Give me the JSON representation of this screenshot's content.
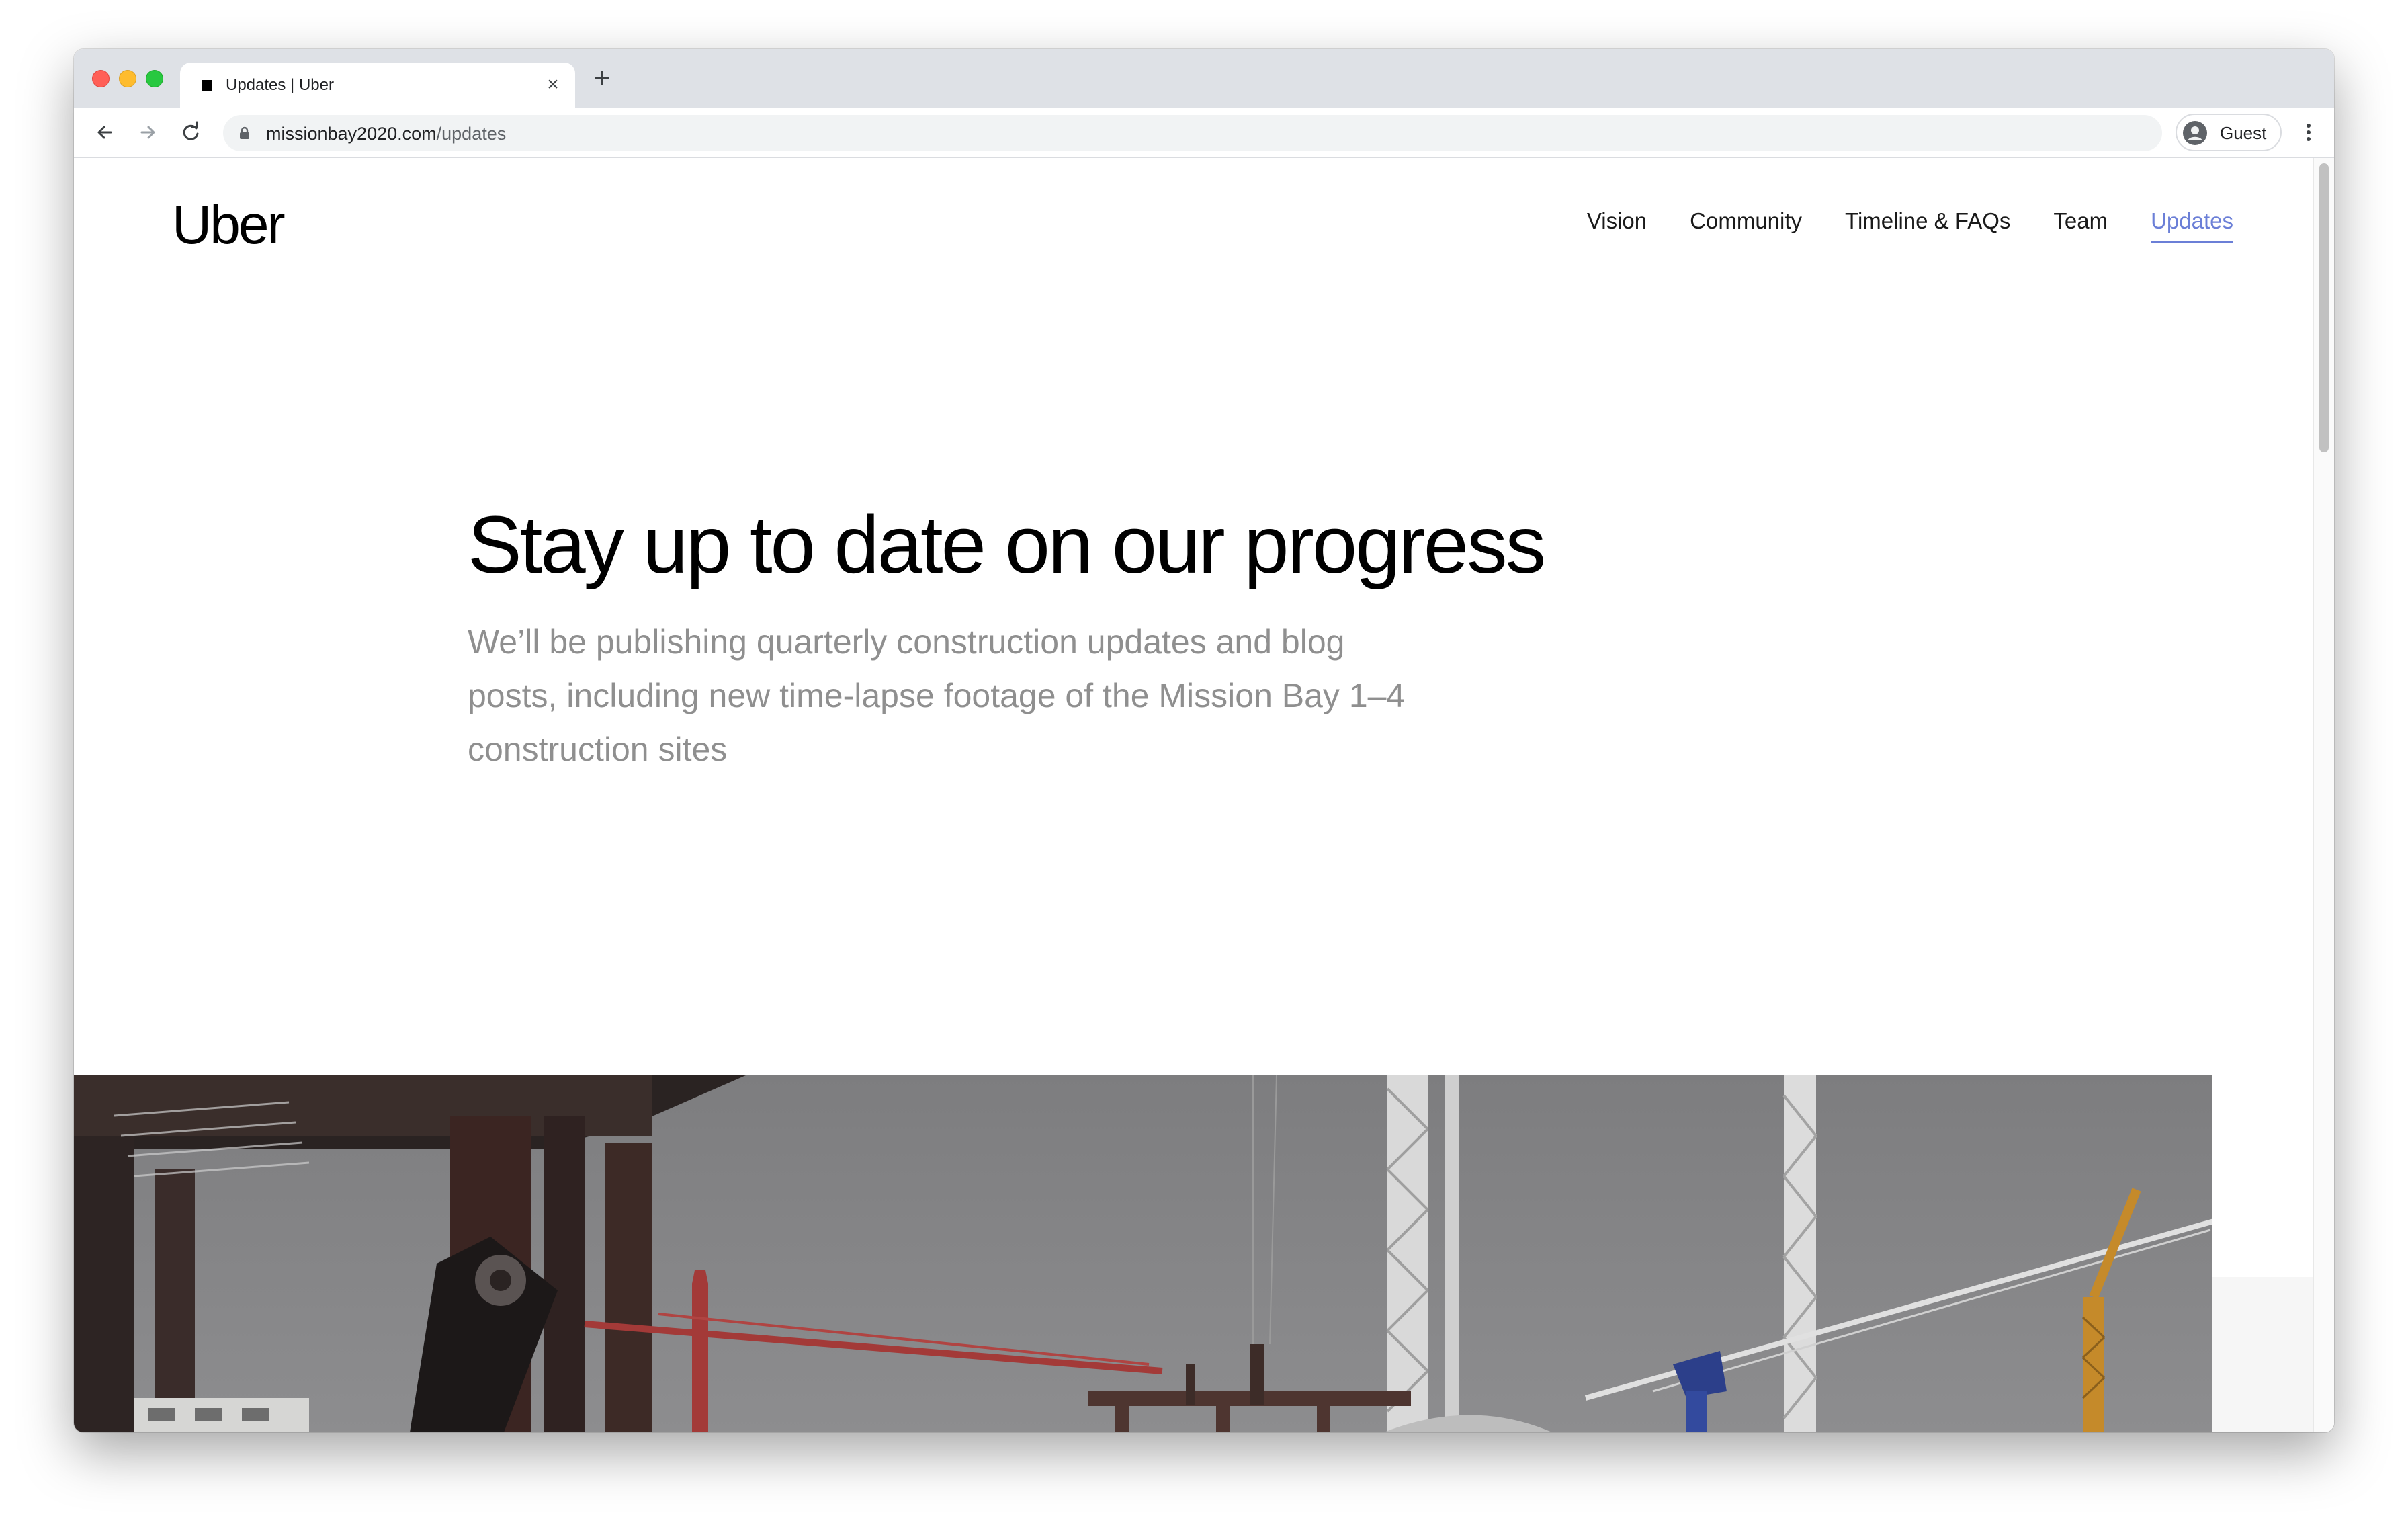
{
  "browser": {
    "tab_title": "Updates | Uber",
    "url_host": "missionbay2020.com",
    "url_path": "/updates",
    "profile_label": "Guest"
  },
  "site": {
    "logo": "Uber",
    "nav": [
      {
        "label": "Vision"
      },
      {
        "label": "Community"
      },
      {
        "label": "Timeline & FAQs"
      },
      {
        "label": "Team"
      },
      {
        "label": "Updates",
        "active": true
      }
    ]
  },
  "hero": {
    "title": "Stay up to date on our progress",
    "subtitle": "We’ll be publishing quarterly construction updates and blog posts, including new time-lapse footage of the Mission Bay 1–4 construction sites"
  },
  "colors": {
    "active_nav": "#6b7fd7",
    "subtitle": "#8f8f8f",
    "tabstrip": "#dee1e6"
  },
  "icons": {
    "back": "arrow-left-icon",
    "forward": "arrow-right-icon",
    "reload": "reload-icon",
    "lock": "lock-icon",
    "profile": "person-circle-icon",
    "menu": "vertical-dots-icon",
    "close_tab": "close-icon",
    "new_tab": "plus-icon"
  }
}
